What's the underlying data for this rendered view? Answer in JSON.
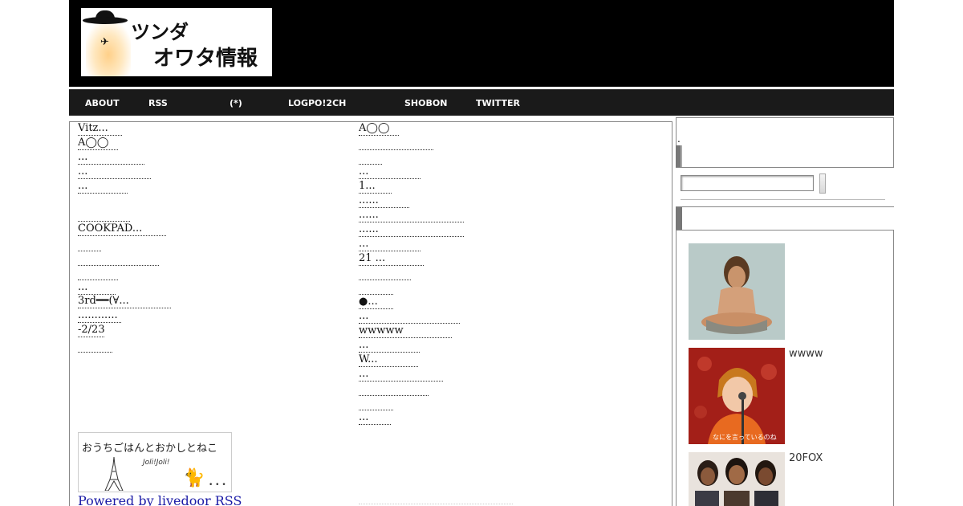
{
  "header": {
    "logo_line1": "ツンダ",
    "logo_line2": "オワタ情報"
  },
  "nav": {
    "items": [
      {
        "label": "ABOUT"
      },
      {
        "label": "RSS"
      },
      {
        "label": "(*)"
      },
      {
        "label": "LOGPO!2CH"
      },
      {
        "label": "SHOBON"
      },
      {
        "label": "TWITTER"
      }
    ]
  },
  "feed": {
    "left": [
      "Vitz...",
      "A◯◯",
      "...",
      "...",
      "...",
      "",
      "",
      "COOKPAD...",
      "",
      "",
      "",
      "...",
      "3rd━━(∀...",
      "............",
      "-2/23",
      ""
    ],
    "right": [
      "A◯◯",
      "",
      "",
      "...",
      "1...",
      " ......",
      "......",
      "......",
      "...",
      " 21 ...",
      "",
      "",
      "●...",
      "...",
      "wwwww",
      "...",
      "W...",
      "...",
      "",
      "",
      "..."
    ]
  },
  "banner": {
    "text": "おうちごはんとおかしとねこ",
    "sub": "Joli!Joli!"
  },
  "powered_by": "Powered by livedoor RSS",
  "sidebar": {
    "dot": ".",
    "search_value": "",
    "thumbnails": [
      {
        "caption": ""
      },
      {
        "caption": "wwww",
        "overlay_text": "なにを言っているのね"
      },
      {
        "caption": "20FOX"
      }
    ]
  }
}
